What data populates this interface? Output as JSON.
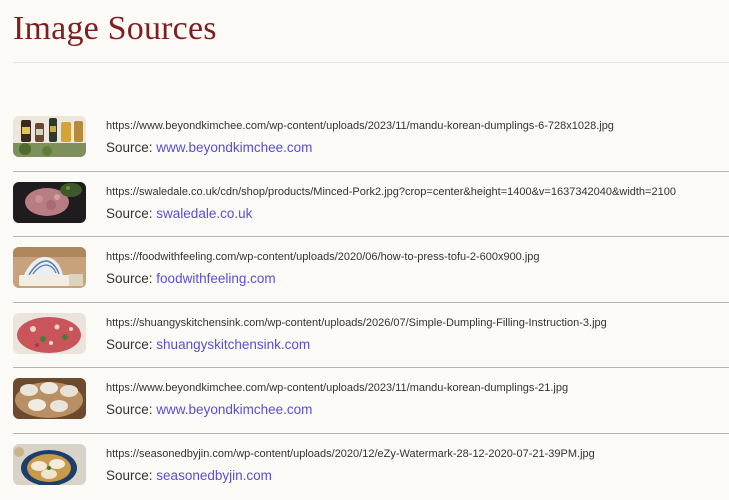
{
  "page": {
    "title": "Image Sources"
  },
  "colors": {
    "title": "#7e1f1f",
    "link": "#5a4fcf",
    "divider": "#b4b4b4",
    "background": "#fcfaf7"
  },
  "sources": [
    {
      "url": "https://www.beyondkimchee.com/wp-content/uploads/2023/11/mandu-korean-dumplings-6-728x1028.jpg",
      "source_label": "Source:",
      "source_site": "www.beyondkimchee.com",
      "thumbnail": "sauce-bottles-thumbnail"
    },
    {
      "url": "https://swaledale.co.uk/cdn/shop/products/Minced-Pork2.jpg?crop=center&height=1400&v=1637342040&width=2100",
      "source_label": "Source:",
      "source_site": "swaledale.co.uk",
      "thumbnail": "minced-pork-thumbnail"
    },
    {
      "url": "https://foodwithfeeling.com/wp-content/uploads/2020/06/how-to-press-tofu-2-600x900.jpg",
      "source_label": "Source:",
      "source_site": "foodwithfeeling.com",
      "thumbnail": "pressed-tofu-thumbnail"
    },
    {
      "url": "https://shuangyskitchensink.com/wp-content/uploads/2026/07/Simple-Dumpling-Filling-Instruction-3.jpg",
      "source_label": "Source:",
      "source_site": "shuangyskitchensink.com",
      "thumbnail": "dumpling-filling-thumbnail"
    },
    {
      "url": "https://www.beyondkimchee.com/wp-content/uploads/2023/11/mandu-korean-dumplings-21.jpg",
      "source_label": "Source:",
      "source_site": "www.beyondkimchee.com",
      "thumbnail": "dumplings-steamer-thumbnail"
    },
    {
      "url": "https://seasonedbyjin.com/wp-content/uploads/2020/12/eZy-Watermark-28-12-2020-07-21-39PM.jpg",
      "source_label": "Source:",
      "source_site": "seasonedbyjin.com",
      "thumbnail": "dumplings-bowl-thumbnail"
    }
  ]
}
